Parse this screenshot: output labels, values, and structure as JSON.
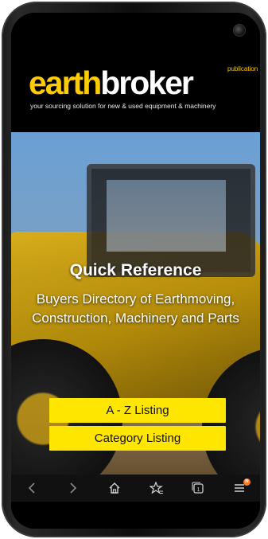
{
  "header": {
    "logo_part1": "earth",
    "logo_part2": "broker",
    "publication_label": "publication",
    "tagline": "your sourcing solution for new & used equipment & machinery"
  },
  "hero": {
    "title": "Quick Reference",
    "subtitle": "Buyers Directory of Earthmoving, Construction, Machinery and Parts"
  },
  "buttons": {
    "az_listing": "A - Z Listing",
    "category_listing": "Category Listing"
  },
  "browser_nav": {
    "items": [
      "back-icon",
      "forward-icon",
      "home-icon",
      "bookmark-star-icon",
      "tabs-icon",
      "menu-icon"
    ],
    "tabs_count": "1",
    "menu_badge": "N"
  },
  "colors": {
    "brand_yellow": "#ffcc00",
    "button_yellow": "#ffe600",
    "badge_orange": "#ff7a1a"
  }
}
